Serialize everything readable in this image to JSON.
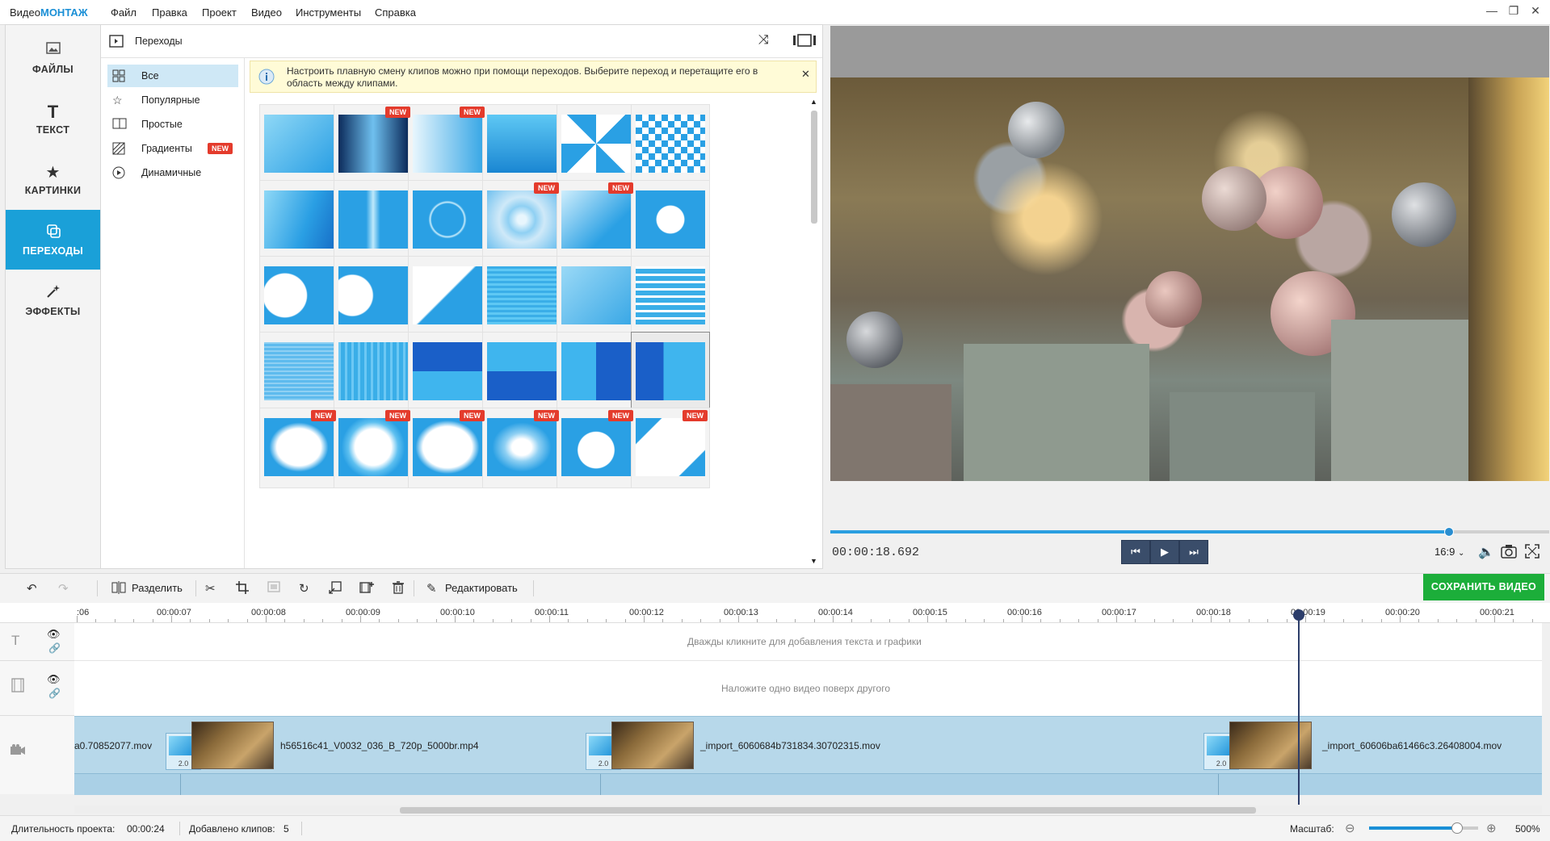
{
  "titlebar": {
    "app_name_prefix": "Видео",
    "app_name_brand": "МОНТАЖ",
    "menu": [
      "Файл",
      "Правка",
      "Проект",
      "Видео",
      "Инструменты",
      "Справка"
    ],
    "controls": {
      "minimize": "—",
      "maximize": "❐",
      "close": "✕"
    }
  },
  "leftnav": [
    {
      "label": "ФАЙЛЫ",
      "icon": "image-icon"
    },
    {
      "label": "ТЕКСТ",
      "icon": "text-icon"
    },
    {
      "label": "КАРТИНКИ",
      "icon": "star-icon"
    },
    {
      "label": "ПЕРЕХОДЫ",
      "icon": "transitions-icon",
      "active": true
    },
    {
      "label": "ЭФФЕКТЫ",
      "icon": "magic-wand-icon"
    }
  ],
  "panel": {
    "title": "Переходы",
    "categories": [
      {
        "label": "Все",
        "selected": true
      },
      {
        "label": "Популярные"
      },
      {
        "label": "Простые"
      },
      {
        "label": "Градиенты",
        "badge": "NEW"
      },
      {
        "label": "Динамичные"
      }
    ],
    "info_line1": "Настроить плавную смену клипов можно при помощи переходов. Выберите переход и перетащите его в",
    "info_line2": "область между клипами.",
    "badge_new": "NEW"
  },
  "preview": {
    "time": "00:00:18.692",
    "progress": 0.86,
    "aspect_ratio": "16:9"
  },
  "toolbar": {
    "split": "Разделить",
    "edit": "Редактировать",
    "save": "СОХРАНИТЬ ВИДЕО"
  },
  "ruler": {
    "labels": [
      ":06",
      "00:00:07",
      "00:00:08",
      "00:00:09",
      "00:00:10",
      "00:00:11",
      "00:00:12",
      "00:00:13",
      "00:00:14",
      "00:00:15",
      "00:00:16",
      "00:00:17",
      "00:00:18",
      "00:00:19",
      "00:00:20",
      "00:00:21"
    ]
  },
  "timeline": {
    "text_hint": "Дважды кликните для добавления текста и графики",
    "overlay_hint": "Наложите одно видео поверх другого",
    "clips": [
      {
        "name": "a0.70852077.mov"
      },
      {
        "name": "h56516c41_V0032_036_B_720p_5000br.mp4"
      },
      {
        "name": "_import_6060684b731834.30702315.mov"
      },
      {
        "name": "_import_60606ba61466c3.26408004.mov"
      }
    ],
    "transition_duration": "2.0"
  },
  "status": {
    "duration_label": "Длительность проекта:",
    "duration_value": "00:00:24",
    "clips_label": "Добавлено клипов:",
    "clips_value": "5",
    "zoom_label": "Масштаб:",
    "zoom_value": "500%"
  }
}
